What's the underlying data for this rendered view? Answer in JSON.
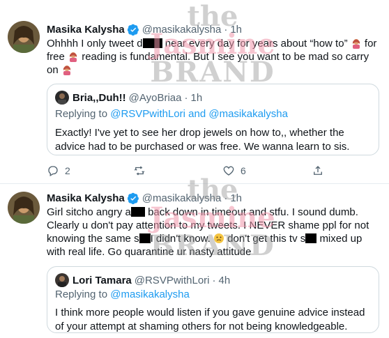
{
  "tweets": [
    {
      "name": "Masika Kalysha",
      "handle": "@masikakalysha",
      "dot": "·",
      "time": "1h",
      "text_parts": [
        "Ohhhh I only tweet d",
        "near every day for years about “how to”",
        "for free",
        "reading is fundamental. But I see you want to be mad so carry on"
      ],
      "quote": {
        "name": "Bria,,Duh!!",
        "handle": "@AyoBriaa",
        "dot": "·",
        "time": "1h",
        "replying_prefix": "Replying to",
        "replying_users": "@RSVPwithLori and @masikakalysha",
        "text": "Exactly! I've yet to see her drop jewels on how to,, whether the advice had to be purchased or was free. We wanna learn to sis."
      },
      "actions": {
        "replies": "2",
        "likes": "6"
      }
    },
    {
      "name": "Masika Kalysha",
      "handle": "@masikakalysha",
      "dot": "·",
      "time": "1h",
      "text_parts": [
        "Girl sitcho angry a",
        "back down in timeout and stfu. I sound dumb. Clearly u don't pay attention to my tweets. I NEVER shame ppl for not knowing the same s",
        "I didn't know.",
        "don't get this tv s",
        "mixed up with real life. Go quarantine ur nasty attitude"
      ],
      "quote": {
        "name": "Lori Tamara",
        "handle": "@RSVPwithLori",
        "dot": "·",
        "time": "4h",
        "replying_prefix": "Replying to",
        "replying_users": "@masikakalysha",
        "text": "I think more people would listen if you gave genuine advice instead of your attempt at shaming others for not being knowledgeable."
      }
    }
  ],
  "watermark": {
    "line1": "the",
    "line2": "Jasmine",
    "line3": "BRAND"
  },
  "colors": {
    "accent": "#1d9bf0",
    "muted": "#536471",
    "border": "#cfd9de"
  }
}
